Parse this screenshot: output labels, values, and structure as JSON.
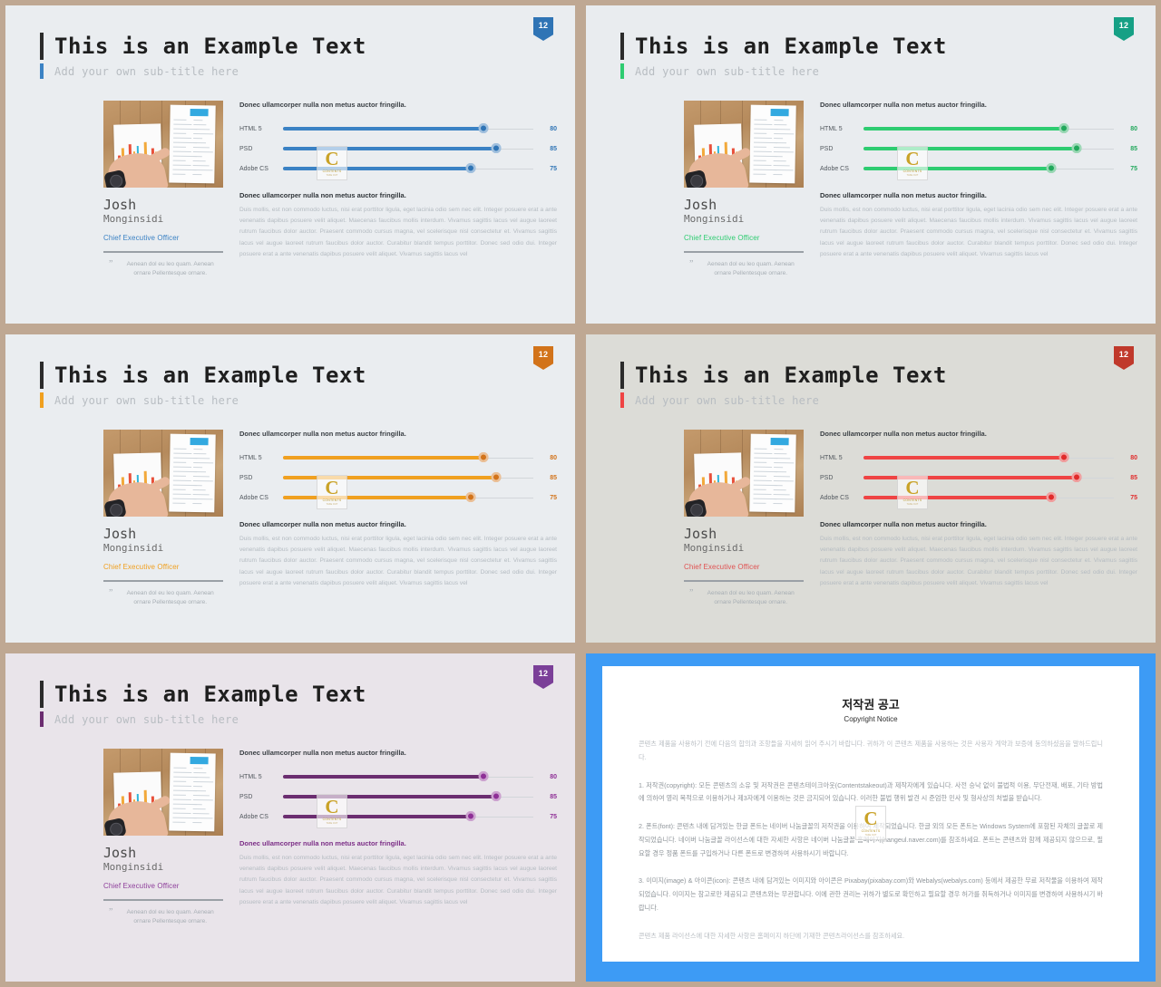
{
  "theme": {
    "page_background": "#bfa893",
    "separator": "#bfa893"
  },
  "common": {
    "title": "This is an Example Text",
    "subtitle": "Add your own sub-title here",
    "badge_number": "12",
    "person": {
      "first_name": "Josh",
      "last_name": "Monginsidi",
      "role": "Chief Executive Officer",
      "quote_mark": "\"",
      "quote": "Aenean dol eu leo quam. Aenean ornare Pellentesque ornare."
    },
    "lead_text": "Donec ullamcorper nulla non metus auctor fringilla.",
    "body_heading": "Donec ullamcorper nulla non metus auctor fringilla.",
    "body_text": "Duis mollis, est non commodo luctus, nisi erat porttitor ligula, eget lacinia odio sem nec elit. Integer posuere erat a ante venenatis dapibus posuere velit aliquet. Maecenas faucibus mollis interdum. Vivamus sagittis lacus vel augue laoreet rutrum faucibus dolor auctor. Praesent commodo cursus magna, vel scelerisque nisl consectetur et. Vivamus sagittis lacus vel augue laoreet rutrum faucibus dolor auctor. Curabitur blandit tempus porttitor. Donec sed odio dui. Integer posuere erat a ante venenatis dapibus posuere velit aliquet. Vivamus sagittis lacus vel",
    "watermark": {
      "letter": "C",
      "name": "CONTENTS",
      "sub": "TAKE OUT"
    }
  },
  "chart_data": {
    "type": "bar",
    "title": "Donec ullamcorper nulla non metus auctor fringilla.",
    "categories": [
      "HTML 5",
      "PSD",
      "Adobe CS"
    ],
    "values": [
      80,
      85,
      75
    ],
    "xlabel": "",
    "ylabel": "",
    "xlim": [
      0,
      100
    ],
    "grid": false,
    "legend": "none",
    "note": "Horizontal slider-style progress bars; value labels shown at right of each track."
  },
  "slides": [
    {
      "id": "slide-blue",
      "accent": "#3b82c4",
      "accent_knob": "#2f74b5",
      "background": "#eaedf0",
      "role_color": "#3b82c4",
      "heading_color": "#2f3438",
      "badge_color": "#2f74b5"
    },
    {
      "id": "slide-green",
      "accent": "#2ecc71",
      "accent_knob": "#22a85c",
      "background": "#e9ecef",
      "role_color": "#2ecc71",
      "heading_color": "#2f3438",
      "badge_color": "#16a085"
    },
    {
      "id": "slide-orange",
      "accent": "#f0a020",
      "accent_knob": "#d2731a",
      "background": "#eaedf0",
      "role_color": "#f0a020",
      "heading_color": "#2f3438",
      "badge_color": "#d2731a"
    },
    {
      "id": "slide-red",
      "accent": "#ef4444",
      "accent_knob": "#e02b2b",
      "background": "#dcdcd7",
      "role_color": "#e05252",
      "heading_color": "#2f3438",
      "badge_color": "#c0392b"
    },
    {
      "id": "slide-purple",
      "accent": "#6b2d70",
      "accent_knob": "#8e2f96",
      "background": "#e9e4ea",
      "role_color": "#8e3f9b",
      "heading_color": "#7b2d86",
      "badge_color": "#7b3f98"
    }
  ],
  "copyright": {
    "frame_color": "#3d9bf5",
    "title_ko": "저작권 공고",
    "title_en": "Copyright Notice",
    "intro": "콘텐츠 제품을 사용하기 전에 다음의 합의과 조항들을 자세히 읽어 주시기 바랍니다. 귀하가 이 콘텐츠 제품을 사용하는 것은 사용자 계약과 보증에 동의하셨음을 말하드립니다.",
    "items": [
      "1. 저작권(copyright): 모든 콘텐츠의 소유 및 저작권은 콘텐츠테이크아웃(Contentstakeout)과 제작자에게 있습니다. 사전 승낙 없이 불법적 이용, 무단전재, 배포, 기타 방법에 의하여 영리 목적으로 이용하거나 제3자에게 이용하는 것은 금지되어 있습니다. 이러한 불법 행위 발견 시 준엄한 민사 및 형사상의 처벌을 받습니다.",
      "2. 폰트(font): 콘텐츠 내에 담겨있는 한글 폰트는 네이버 나눔글꼴의 저작권을 이용하여 제작되었습니다. 한글 외의 모든 폰트는 Windows System에 포함된 자체의 글꼴로 제작되었습니다. 네이버 나눔글꼴 라이선스에 대한 자세한 사항은 네이버 나눔글꼴 홈페이지(hangeul.naver.com)를 참조하세요. 폰트는 콘텐츠와 함께 제공되지 않으므로, 필요할 경우 정품 폰트를 구입하거나 다른 폰트로 변경하여 사용하시기 바랍니다.",
      "3. 이미지(image) & 아이콘(icon): 콘텐츠 내에 담겨있는 이미지와 아이콘은 Pixabay(pixabay.com)와 Webalys(webalys.com) 등에서 제공한 무료 저작물을 이용하여 제작되었습니다. 이미지는 참고로만 제공되고 콘텐츠와는 무관합니다. 이에 관한 권리는 귀하가 별도로 확인하고 필요할 경우 허가를 취득하거나 이미지를 변경하여 사용하시기 바랍니다."
    ],
    "footer": "콘텐츠 제품 라이선스에 대한 자세한 사항은 홈페이지 하단에 기재한 콘텐츠라이선스를 참조하세요."
  }
}
